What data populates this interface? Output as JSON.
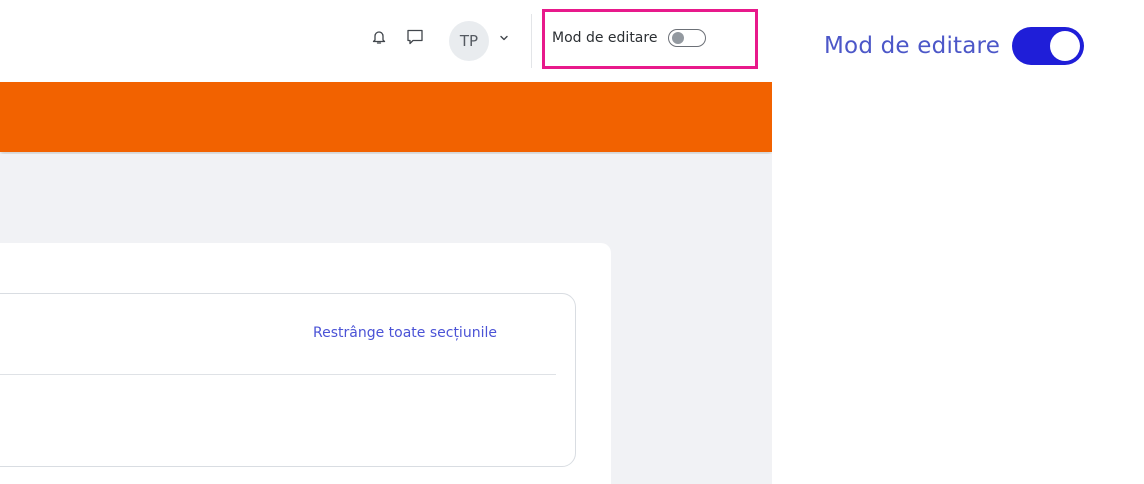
{
  "navbar": {
    "avatar_initials": "TP",
    "icons": [
      "bell-icon",
      "chat-icon",
      "chevron-down-icon"
    ],
    "edit_mode": {
      "label": "Mod de editare",
      "on": false
    }
  },
  "course": {
    "collapse_all_label": "Restrânge toate secțiunile"
  },
  "zoomed_toggle": {
    "label": "Mod de editare",
    "on": true
  },
  "colors": {
    "brand_orange": "#f26200",
    "highlight_pink": "#e8198b",
    "toggle_on_blue": "#1f1ed8",
    "link_blue": "#4b53d6"
  }
}
